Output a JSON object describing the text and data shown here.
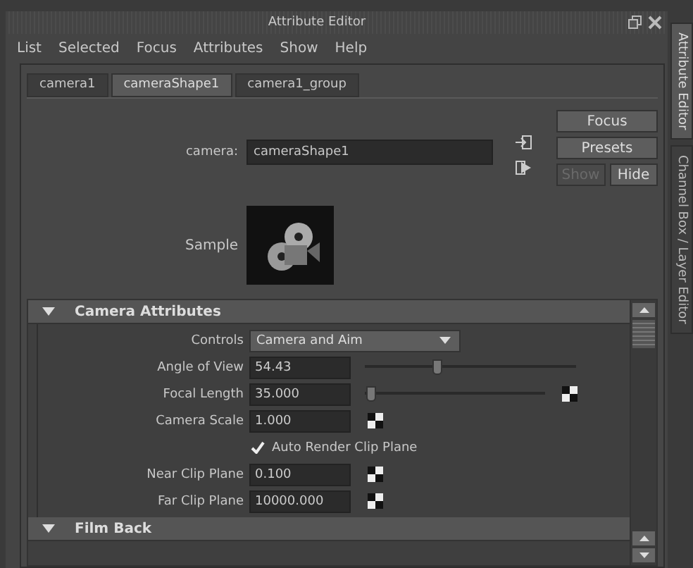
{
  "window": {
    "title": "Attribute Editor"
  },
  "menu": [
    "List",
    "Selected",
    "Focus",
    "Attributes",
    "Show",
    "Help"
  ],
  "tabs": [
    {
      "label": "camera1",
      "selected": false
    },
    {
      "label": "cameraShape1",
      "selected": true
    },
    {
      "label": "camera1_group",
      "selected": false
    }
  ],
  "node": {
    "label": "camera:",
    "value": "cameraShape1"
  },
  "buttons": [
    {
      "label": "Focus",
      "disabled": false
    },
    {
      "label": "Presets",
      "disabled": false
    }
  ],
  "show_hide": [
    {
      "label": "Show",
      "disabled": true
    },
    {
      "label": "Hide",
      "disabled": false
    }
  ],
  "sample": {
    "label": "Sample"
  },
  "sections": [
    {
      "title": "Camera Attributes",
      "expanded": true,
      "rows": [
        {
          "kind": "dropdown",
          "label": "Controls",
          "value": "Camera and Aim"
        },
        {
          "kind": "slider",
          "label": "Angle of View",
          "value": "54.43",
          "level": 0.34,
          "has_map": false
        },
        {
          "kind": "slider",
          "label": "Focal Length",
          "value": "35.000",
          "level": 0.03,
          "has_map": true
        },
        {
          "kind": "field",
          "label": "Camera Scale",
          "value": "1.000",
          "has_map": true
        },
        {
          "kind": "checkbox",
          "label": "Auto Render Clip Plane",
          "checked": true
        },
        {
          "kind": "field",
          "label": "Near Clip Plane",
          "value": "0.100",
          "has_map": true
        },
        {
          "kind": "field",
          "label": "Far Clip Plane",
          "value": "10000.000",
          "has_map": true
        }
      ]
    },
    {
      "title": "Film Back",
      "expanded": true
    }
  ],
  "side_tabs": [
    {
      "label": "Attribute Editor",
      "selected": true
    },
    {
      "label": "Channel Box / Layer Editor",
      "selected": false
    }
  ]
}
